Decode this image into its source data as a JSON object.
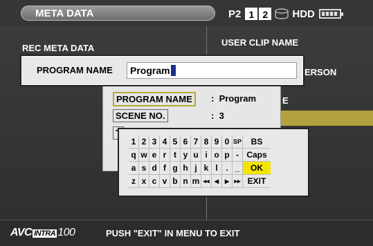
{
  "header": {
    "title": "META DATA",
    "media_label": "P2",
    "slots": [
      "1",
      "2"
    ],
    "hdd_label": "HDD",
    "battery_level": 0.8
  },
  "left_panel": {
    "title": "REC META DATA"
  },
  "right_panel": {
    "title": "USER CLIP NAME",
    "fragment_1": "ERSON",
    "fragment_2": "E",
    "highlight_color": "#b2a23e"
  },
  "program_dialog": {
    "label": "PROGRAM NAME",
    "value": "Program"
  },
  "meta_list": [
    {
      "key": "PROGRAM NAME",
      "sep": ":",
      "value": "Program",
      "selected": true
    },
    {
      "key": "SCENE NO.",
      "sep": ":",
      "value": "3",
      "selected": false
    },
    {
      "key": "T",
      "sep": "",
      "value": "",
      "selected": false
    }
  ],
  "keyboard": {
    "rows": [
      {
        "keys": [
          "1",
          "2",
          "3",
          "4",
          "5",
          "6",
          "7",
          "8",
          "9",
          "0",
          "SP"
        ],
        "fn": "BS"
      },
      {
        "keys": [
          "q",
          "w",
          "e",
          "r",
          "t",
          "y",
          "u",
          "i",
          "o",
          "p",
          "-"
        ],
        "fn": "Caps"
      },
      {
        "keys": [
          "a",
          "s",
          "d",
          "f",
          "g",
          "h",
          "j",
          "k",
          "l",
          ".",
          "_"
        ],
        "fn": "OK"
      },
      {
        "keys": [
          "z",
          "x",
          "c",
          "v",
          "b",
          "n",
          "m",
          "◂◂",
          "◂",
          "▸",
          "▸▸"
        ],
        "fn": "EXIT"
      }
    ],
    "highlight_color": "#f2e600"
  },
  "footer": {
    "logo_prefix": "AVC",
    "logo_badge": "INTRA",
    "logo_number": "100",
    "message": "PUSH \"EXIT\" IN MENU TO EXIT"
  }
}
